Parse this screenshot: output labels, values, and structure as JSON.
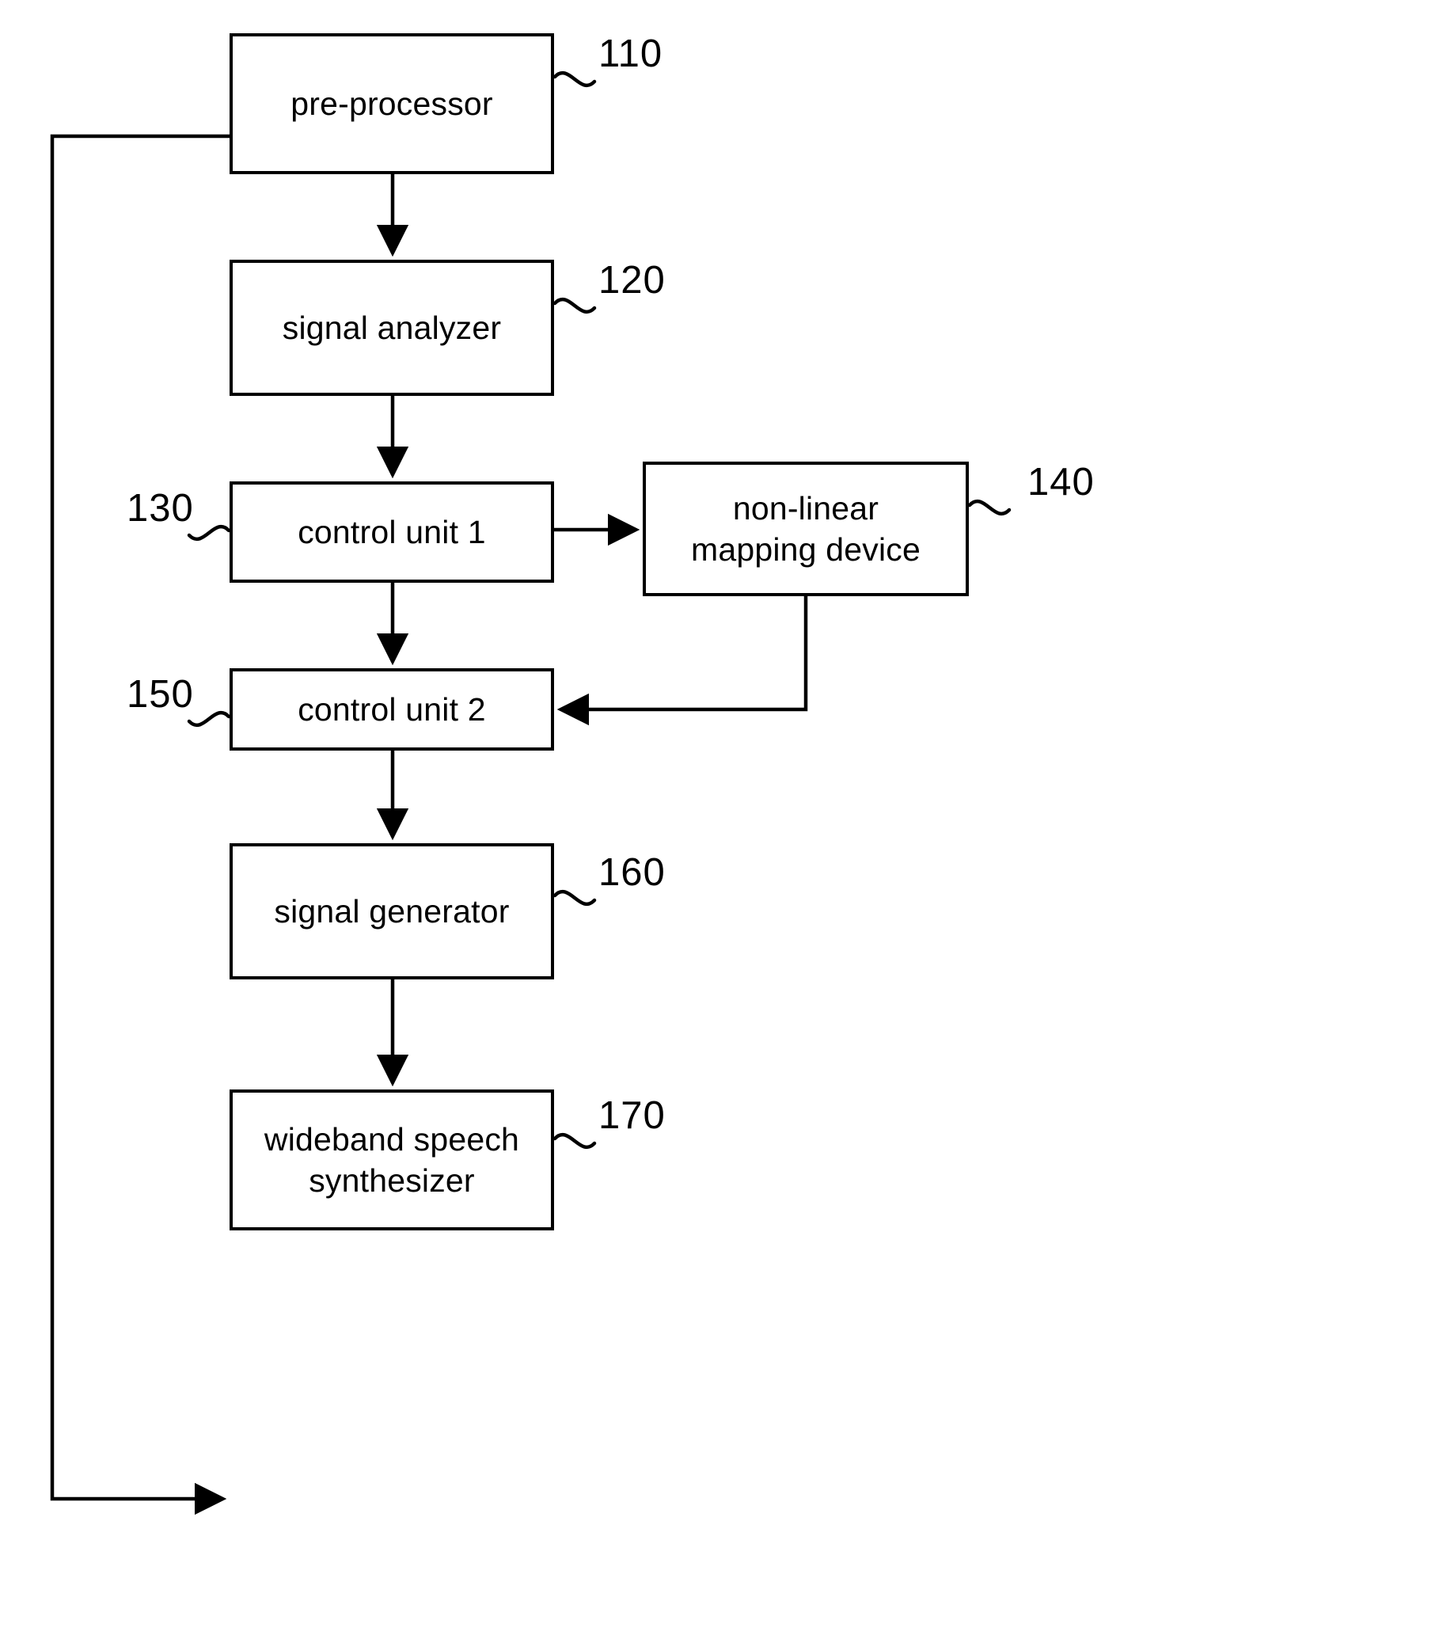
{
  "figure": {
    "type": "patent-block-diagram",
    "background_color": "#ffffff",
    "line_color": "#000000"
  },
  "blocks": [
    {
      "id": "110",
      "label": "pre-processor",
      "ref": "110"
    },
    {
      "id": "120",
      "label": "signal analyzer",
      "ref": "120"
    },
    {
      "id": "130",
      "label": "control unit 1",
      "ref": "130"
    },
    {
      "id": "140",
      "label": "non-linear\nmapping device",
      "ref": "140"
    },
    {
      "id": "150",
      "label": "control unit 2",
      "ref": "150"
    },
    {
      "id": "160",
      "label": "signal generator",
      "ref": "160"
    },
    {
      "id": "170",
      "label": "wideband speech\nsynthesizer",
      "ref": "170"
    }
  ],
  "connections": [
    {
      "from": "110",
      "to": "120",
      "style": "arrow-down"
    },
    {
      "from": "120",
      "to": "130",
      "style": "arrow-down"
    },
    {
      "from": "130",
      "to": "140",
      "style": "arrow-right"
    },
    {
      "from": "130",
      "to": "150",
      "style": "arrow-down"
    },
    {
      "from": "140",
      "to": "150",
      "style": "elbow-arrow-left"
    },
    {
      "from": "150",
      "to": "160",
      "style": "arrow-down"
    },
    {
      "from": "160",
      "to": "170",
      "style": "arrow-down"
    },
    {
      "from": "110",
      "to": "170",
      "style": "feedback-left-arrow-right"
    }
  ]
}
